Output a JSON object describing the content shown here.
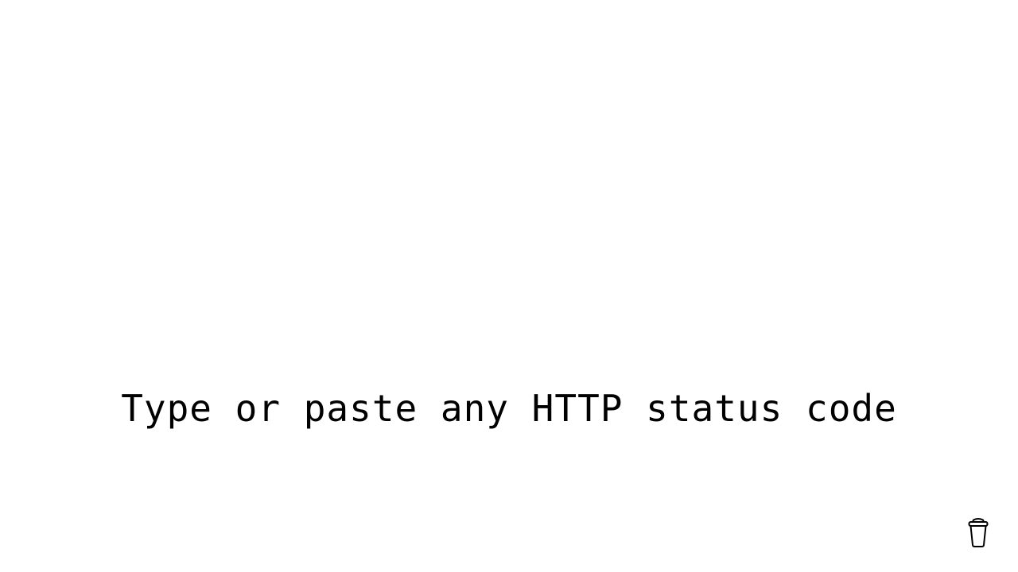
{
  "main": {
    "prompt_text": "Type or paste any HTTP status code"
  },
  "footer": {
    "support_icon": "coffee-cup-icon"
  },
  "colors": {
    "background": "#ffffff",
    "text": "#000000"
  }
}
